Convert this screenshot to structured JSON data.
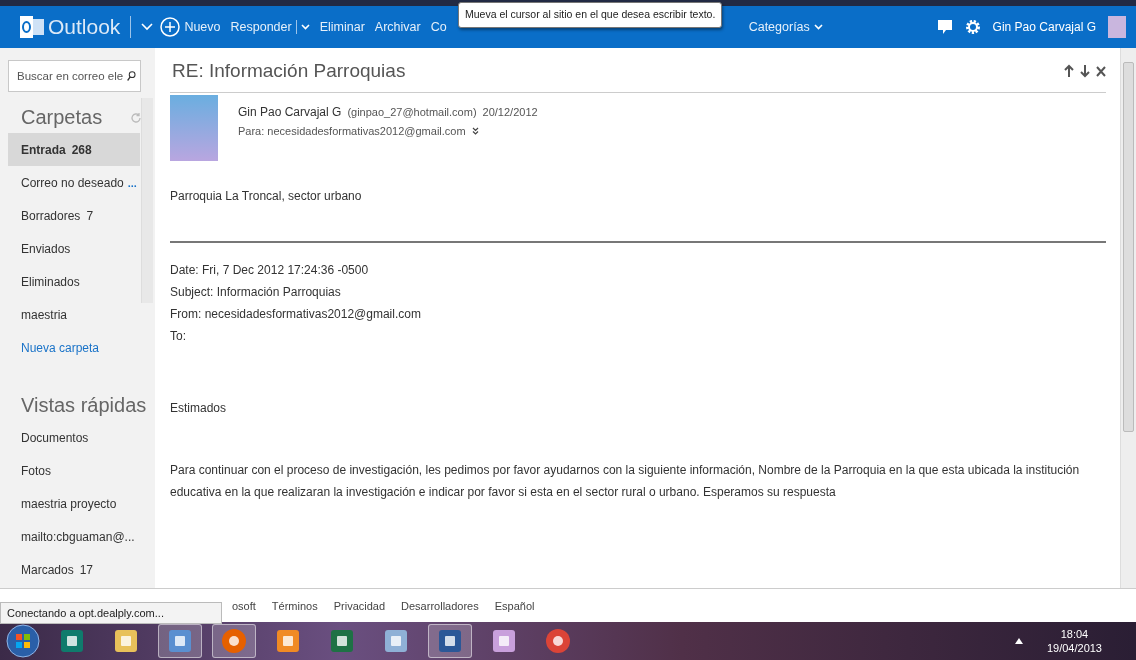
{
  "header": {
    "brand": "Outlook",
    "toolbar": [
      {
        "kind": "new",
        "label": "Nuevo"
      },
      {
        "kind": "split",
        "label": "Responder"
      },
      {
        "kind": "plain",
        "label": "Eliminar"
      },
      {
        "kind": "plain",
        "label": "Archivar"
      },
      {
        "kind": "plain",
        "label": "Co"
      },
      {
        "kind": "menu",
        "label": "Categorías"
      }
    ],
    "user": "Gin Pao Carvajal G",
    "tooltip": "Mueva el cursor al sitio en el que desea escribir texto."
  },
  "sidebar": {
    "search": {
      "placeholder": "Buscar en correo ele"
    },
    "folders_title": "Carpetas",
    "folders": [
      {
        "label": "Entrada",
        "count": "268",
        "selected": true,
        "kind": "folder"
      },
      {
        "label": "Correo no deseado",
        "count": "...",
        "selected": false,
        "kind": "folder"
      },
      {
        "label": "Borradores",
        "count": "7",
        "selected": false,
        "kind": "folder"
      },
      {
        "label": "Enviados",
        "selected": false,
        "kind": "folder"
      },
      {
        "label": "Eliminados",
        "selected": false,
        "kind": "folder"
      },
      {
        "label": "maestria",
        "selected": false,
        "kind": "folder"
      },
      {
        "label": "Nueva carpeta",
        "selected": false,
        "kind": "link"
      }
    ],
    "views_title": "Vistas rápidas",
    "views": [
      {
        "label": "Documentos"
      },
      {
        "label": "Fotos"
      },
      {
        "label": "maestria proyecto"
      },
      {
        "label": "mailto:cbguaman@..."
      },
      {
        "label": "Marcados",
        "count": "17"
      }
    ]
  },
  "message": {
    "subject": "RE: Información Parroquias",
    "sender": "Gin Pao Carvajal G",
    "sender_email": "(ginpao_27@hotmail.com)",
    "date": "20/12/2012",
    "to": "Para: necesidadesformativas2012@gmail.com",
    "reply": "Parroquia La Troncal, sector urbano",
    "quoted_headers": [
      "Date: Fri, 7 Dec 2012 17:24:36 -0500",
      "Subject: Información Parroquias",
      "From: necesidadesformativas2012@gmail.com",
      "To:"
    ],
    "greeting": "Estimados",
    "body": "Para continuar con el proceso de investigación, les pedimos por favor ayudarnos con la siguiente información, Nombre de la Parroquia en la que esta ubicada la institución educativa en la que realizaran la investigación e indicar por favor si esta en el sector rural o urbano. Esperamos su respuesta"
  },
  "footer": {
    "copyright": "osoft",
    "links": [
      "Términos",
      "Privacidad",
      "Desarrolladores",
      "Español"
    ]
  },
  "status_bar": "Conectando a opt.dealply.com...",
  "taskbar": {
    "apps": [
      {
        "kind": "publisher",
        "selected": false
      },
      {
        "kind": "folder",
        "selected": false
      },
      {
        "kind": "desktop",
        "selected": true
      },
      {
        "kind": "firefox",
        "selected": true
      },
      {
        "kind": "media",
        "selected": false
      },
      {
        "kind": "excel",
        "selected": false
      },
      {
        "kind": "calculator",
        "selected": false
      },
      {
        "kind": "word",
        "selected": true
      },
      {
        "kind": "paint",
        "selected": false
      },
      {
        "kind": "chrome",
        "selected": false
      }
    ],
    "time": "18:04",
    "date": "19/04/2013"
  }
}
